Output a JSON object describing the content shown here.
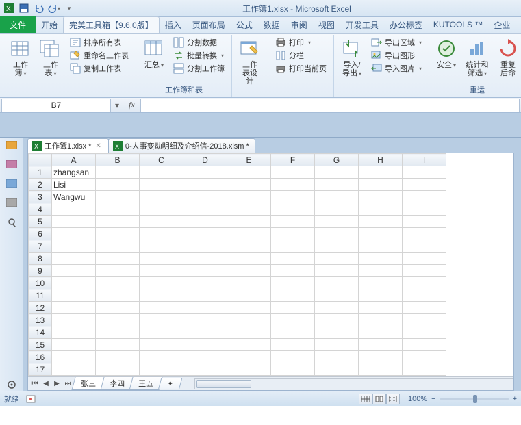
{
  "window": {
    "title": "工作簿1.xlsx  -  Microsoft Excel"
  },
  "tabs": {
    "file": "文件",
    "items": [
      "开始",
      "完美工具箱【9.6.0版】",
      "插入",
      "页面布局",
      "公式",
      "数据",
      "审阅",
      "视图",
      "开发工具",
      "办公标签",
      "KUTOOLS ™",
      "企业"
    ]
  },
  "ribbon": {
    "group1": {
      "btn1": "工作簿",
      "btn2": "工作表",
      "c1": "排序所有表",
      "c2": "重命名工作表",
      "c3": "复制工作表"
    },
    "group2": {
      "btn": "汇总",
      "c1": "分割数据",
      "c2": "批量转换",
      "c3": "分割工作簿",
      "label": "工作簿和表"
    },
    "group3": {
      "btn": "工作表设计"
    },
    "group4": {
      "c1": "打印",
      "c2": "分栏",
      "c3": "打印当前页"
    },
    "group5": {
      "btn": "导入/导出",
      "c1": "导出区域",
      "c2": "导出图形",
      "c3": "导入图片"
    },
    "group6": {
      "btn1": "安全",
      "btn2": "统计和筛选",
      "btn3": "重复后命",
      "label": "重运"
    }
  },
  "namebox": {
    "value": "B7"
  },
  "workbook_tabs": [
    {
      "name": "工作簿1.xlsx *",
      "active": true
    },
    {
      "name": "0-人事变动明细及介绍信-2018.xlsm *",
      "active": false
    }
  ],
  "columns": [
    "A",
    "B",
    "C",
    "D",
    "E",
    "F",
    "G",
    "H",
    "I"
  ],
  "rows": 17,
  "cells": {
    "A1": "zhangsan",
    "A2": "Lisi",
    "A3": "Wangwu"
  },
  "sheet_tabs": [
    "张三",
    "李四",
    "王五"
  ],
  "status": {
    "ready": "就绪",
    "zoom": "100%"
  }
}
